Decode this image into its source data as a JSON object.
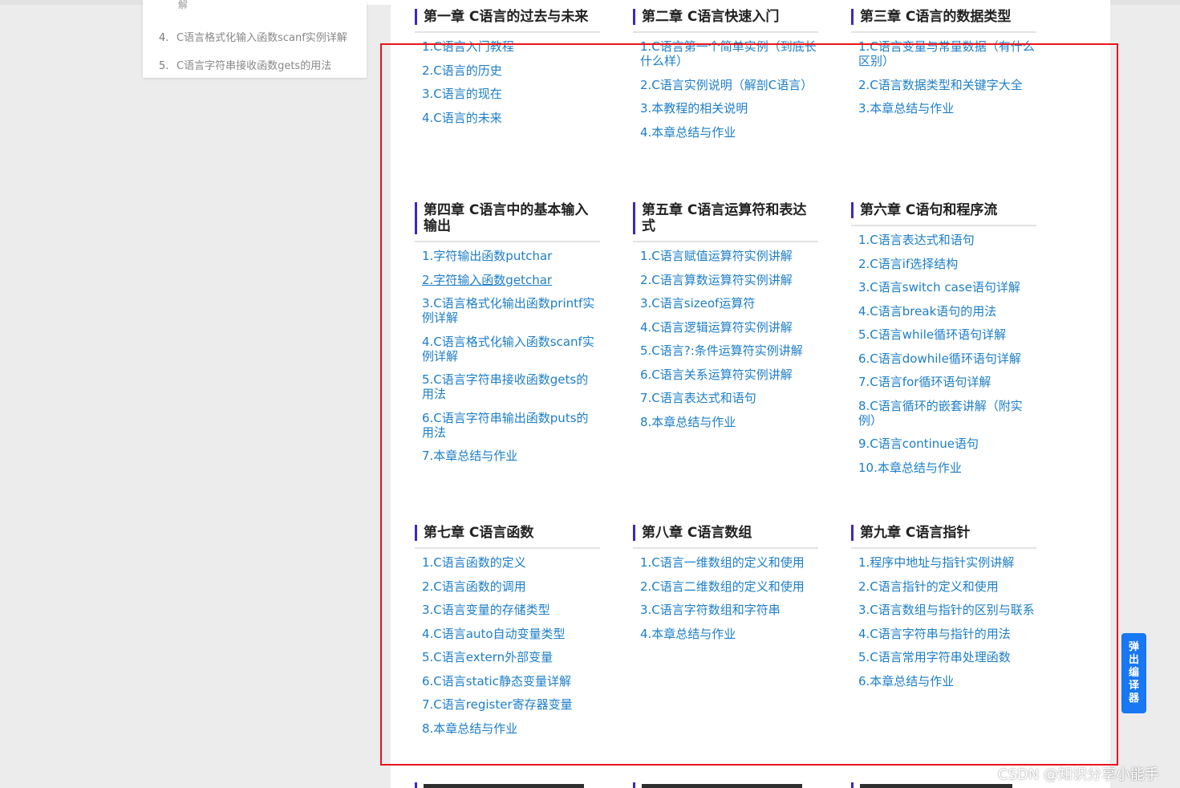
{
  "sidebar": {
    "fragment": "解",
    "items": [
      {
        "num": "4.",
        "label": "C语言格式化输入函数scanf实例详解"
      },
      {
        "num": "5.",
        "label": "C语言字符串接收函数gets的用法"
      }
    ]
  },
  "chapters": [
    {
      "title": "第一章 C语言的过去与未来",
      "items": [
        "1.C语言入门教程",
        "2.C语言的历史",
        "3.C语言的现在",
        "4.C语言的未来"
      ]
    },
    {
      "title": "第二章 C语言快速入门",
      "items": [
        "1.C语言第一个简单实例（到底长什么样）",
        "2.C语言实例说明（解剖C语言）",
        "3.本教程的相关说明",
        "4.本章总结与作业"
      ]
    },
    {
      "title": "第三章 C语言的数据类型",
      "items": [
        "1.C语言变量与常量数据（有什么区别）",
        "2.C语言数据类型和关键字大全",
        "3.本章总结与作业"
      ]
    },
    {
      "title": "第四章 C语言中的基本输入输出",
      "items": [
        "1.字符输出函数putchar",
        "2.字符输入函数getchar",
        "3.C语言格式化输出函数printf实例详解",
        "4.C语言格式化输入函数scanf实例详解",
        "5.C语言字符串接收函数gets的用法",
        "6.C语言字符串输出函数puts的用法",
        "7.本章总结与作业"
      ]
    },
    {
      "title": "第五章 C语言运算符和表达式",
      "items": [
        "1.C语言赋值运算符实例讲解",
        "2.C语言算数运算符实例讲解",
        "3.C语言sizeof运算符",
        "4.C语言逻辑运算符实例讲解",
        "5.C语言?:条件运算符实例讲解",
        "6.C语言关系运算符实例讲解",
        "7.C语言表达式和语句",
        "8.本章总结与作业"
      ]
    },
    {
      "title": "第六章 C语句和程序流",
      "items": [
        "1.C语言表达式和语句",
        "2.C语言if选择结构",
        "3.C语言switch case语句详解",
        "4.C语言break语句的用法",
        "5.C语言while循环语句详解",
        "6.C语言dowhile循环语句详解",
        "7.C语言for循环语句详解",
        "8.C语言循环的嵌套讲解（附实例）",
        "9.C语言continue语句",
        "10.本章总结与作业"
      ]
    },
    {
      "title": "第七章 C语言函数",
      "items": [
        "1.C语言函数的定义",
        "2.C语言函数的调用",
        "3.C语言变量的存储类型",
        "4.C语言auto自动变量类型",
        "5.C语言extern外部变量",
        "6.C语言static静态变量详解",
        "7.C语言register寄存器变量",
        "8.本章总结与作业"
      ]
    },
    {
      "title": "第八章 C语言数组",
      "items": [
        "1.C语言一维数组的定义和使用",
        "2.C语言二维数组的定义和使用",
        "3.C语言字符数组和字符串",
        "4.本章总结与作业"
      ]
    },
    {
      "title": "第九章 C语言指针",
      "items": [
        "1.程序中地址与指针实例讲解",
        "2.C语言指针的定义和使用",
        "3.C语言数组与指针的区别与联系",
        "4.C语言字符串与指针的用法",
        "5.C语言常用字符串处理函数",
        "6.本章总结与作业"
      ]
    }
  ],
  "compiler_button": {
    "label": "弹出编译器"
  },
  "watermark": "CSDN @知识分享小能手",
  "colors": {
    "link": "#1d7ec8",
    "accent_bar": "#3b28c8",
    "highlight_frame": "#e8141c",
    "compiler_button": "#1877f2"
  }
}
